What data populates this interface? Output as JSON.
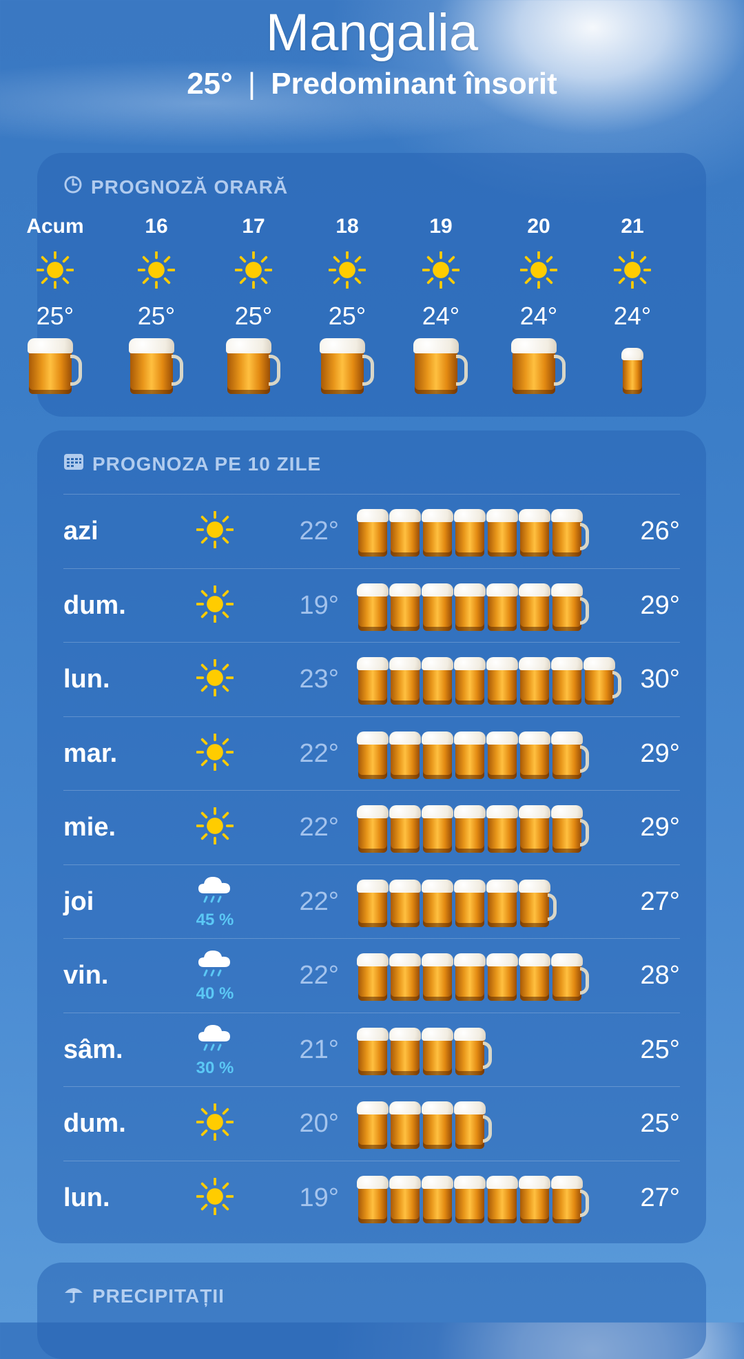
{
  "header": {
    "city": "Mangalia",
    "temp": "25°",
    "separator": "|",
    "condition": "Predominant însorit"
  },
  "hourly": {
    "title": "PROGNOZĂ ORARĂ",
    "icon": "clock-icon",
    "items": [
      {
        "time": "Acum",
        "icon": "sun-icon",
        "temp": "25°",
        "mug_fill": 1.0
      },
      {
        "time": "16",
        "icon": "sun-icon",
        "temp": "25°",
        "mug_fill": 1.0
      },
      {
        "time": "17",
        "icon": "sun-icon",
        "temp": "25°",
        "mug_fill": 1.0
      },
      {
        "time": "18",
        "icon": "sun-icon",
        "temp": "25°",
        "mug_fill": 1.0
      },
      {
        "time": "19",
        "icon": "sun-icon",
        "temp": "24°",
        "mug_fill": 1.0
      },
      {
        "time": "20",
        "icon": "sun-icon",
        "temp": "24°",
        "mug_fill": 1.0
      },
      {
        "time": "21",
        "icon": "sun-icon",
        "temp": "24°",
        "mug_fill": 0.45
      }
    ]
  },
  "daily": {
    "title": "PROGNOZA PE 10 ZILE",
    "icon": "calendar-icon",
    "days": [
      {
        "day": "azi",
        "icon": "sun-icon",
        "precip": "",
        "low": "22°",
        "high": "26°",
        "mugs": 7
      },
      {
        "day": "dum.",
        "icon": "sun-icon",
        "precip": "",
        "low": "19°",
        "high": "29°",
        "mugs": 7
      },
      {
        "day": "lun.",
        "icon": "sun-icon",
        "precip": "",
        "low": "23°",
        "high": "30°",
        "mugs": 8
      },
      {
        "day": "mar.",
        "icon": "sun-icon",
        "precip": "",
        "low": "22°",
        "high": "29°",
        "mugs": 7
      },
      {
        "day": "mie.",
        "icon": "sun-icon",
        "precip": "",
        "low": "22°",
        "high": "29°",
        "mugs": 7
      },
      {
        "day": "joi",
        "icon": "rain-cloud-icon",
        "precip": "45 %",
        "low": "22°",
        "high": "27°",
        "mugs": 6
      },
      {
        "day": "vin.",
        "icon": "rain-cloud-icon",
        "precip": "40 %",
        "low": "22°",
        "high": "28°",
        "mugs": 7
      },
      {
        "day": "sâm.",
        "icon": "rain-cloud-icon",
        "precip": "30 %",
        "low": "21°",
        "high": "25°",
        "mugs": 4
      },
      {
        "day": "dum.",
        "icon": "sun-icon",
        "precip": "",
        "low": "20°",
        "high": "25°",
        "mugs": 4
      },
      {
        "day": "lun.",
        "icon": "sun-icon",
        "precip": "",
        "low": "19°",
        "high": "27°",
        "mugs": 7
      }
    ]
  },
  "precipitation": {
    "title": "PRECIPITAȚII",
    "icon": "umbrella-icon"
  },
  "colors": {
    "sun": "#ffcc00",
    "precip_text": "#5bc8f5",
    "beer": "#e8961a",
    "foam": "#f5f1e6"
  }
}
